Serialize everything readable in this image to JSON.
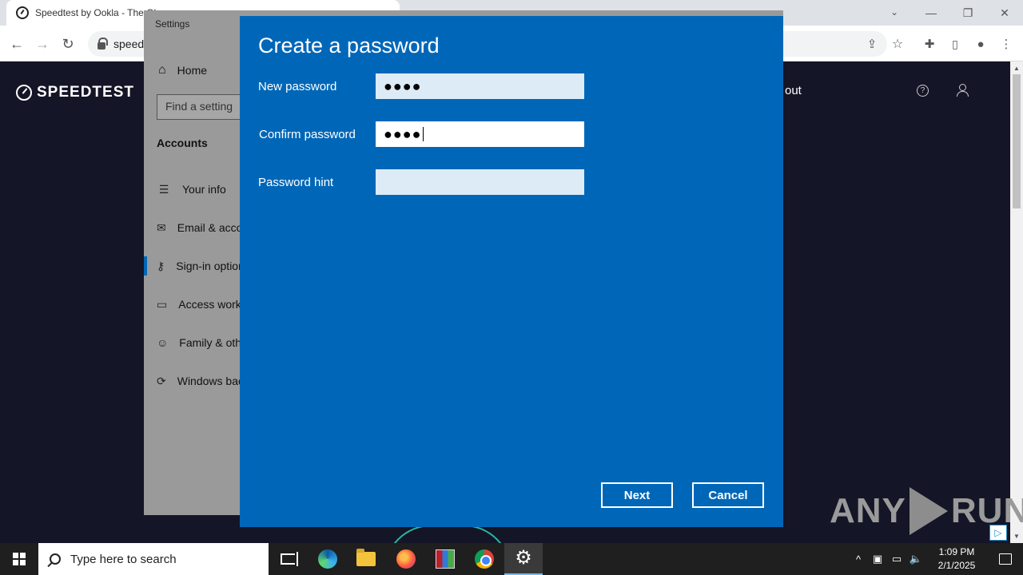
{
  "browser": {
    "tab_title": "Speedtest by Ookla - The Gl",
    "url_text": "speed",
    "controls": {
      "minimize": "—",
      "restore": "❐",
      "close": "✕",
      "dropdown": "⌄"
    },
    "nav": {
      "back": "←",
      "forward": "→",
      "reload": "↻"
    }
  },
  "speedtest": {
    "logo_text": "SPEEDTEST",
    "nav_about": "out",
    "help_glyph": "?"
  },
  "settings": {
    "window_title": "Settings",
    "home_label": "Home",
    "search_placeholder": "Find a setting",
    "section_title": "Accounts",
    "nav_items": [
      {
        "label": "Your info",
        "icon": "person-list-icon"
      },
      {
        "label": "Email & accounts",
        "icon": "mail-icon"
      },
      {
        "label": "Sign-in options",
        "icon": "key-icon"
      },
      {
        "label": "Access work or school",
        "icon": "briefcase-icon"
      },
      {
        "label": "Family & other users",
        "icon": "person-add-icon"
      },
      {
        "label": "Windows backup",
        "icon": "sync-icon"
      }
    ]
  },
  "dialog": {
    "title": "Create a password",
    "new_password_label": "New password",
    "new_password_value": "●●●●",
    "confirm_password_label": "Confirm password",
    "confirm_password_value": "●●●●",
    "hint_label": "Password hint",
    "hint_value": "",
    "next_label": "Next",
    "cancel_label": "Cancel",
    "accent_color": "#0067b8"
  },
  "watermark": {
    "text_left": "ANY",
    "text_right": "RUN"
  },
  "taskbar": {
    "search_placeholder": "Type here to search",
    "time": "1:09 PM",
    "date": "2/1/2025",
    "pinned": [
      "task-view-icon",
      "edge-icon",
      "file-explorer-icon",
      "firefox-icon",
      "winrar-icon",
      "chrome-icon",
      "settings-gear-icon"
    ]
  }
}
